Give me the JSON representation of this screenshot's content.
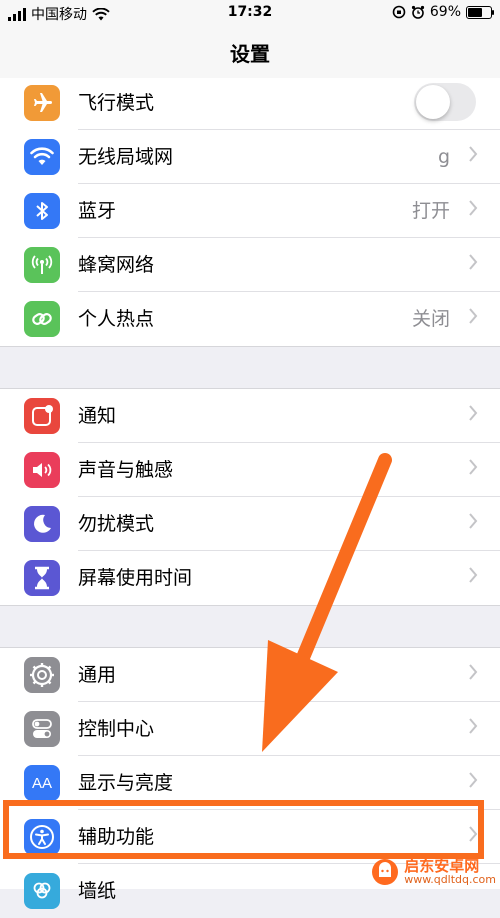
{
  "status_bar": {
    "carrier": "中国移动",
    "time": "17:32",
    "battery_percent": "69%",
    "battery_level": 0.69
  },
  "nav": {
    "title": "设置"
  },
  "group1": [
    {
      "label": "飞行模式",
      "icon": "airplane-icon",
      "color": "#f19a37",
      "toggle": false
    },
    {
      "label": "无线局域网",
      "icon": "wifi-icon",
      "color": "#3478f6",
      "value": "g"
    },
    {
      "label": "蓝牙",
      "icon": "bluetooth-icon",
      "color": "#3478f6",
      "value": "打开"
    },
    {
      "label": "蜂窝网络",
      "icon": "antenna-icon",
      "color": "#5ac35a"
    },
    {
      "label": "个人热点",
      "icon": "hotspot-icon",
      "color": "#5ac35a",
      "value": "关闭"
    }
  ],
  "group2": [
    {
      "label": "通知",
      "icon": "notification-icon",
      "color": "#e9473d"
    },
    {
      "label": "声音与触感",
      "icon": "speaker-icon",
      "color": "#ea3d5b"
    },
    {
      "label": "勿扰模式",
      "icon": "moon-icon",
      "color": "#5b57d3"
    },
    {
      "label": "屏幕使用时间",
      "icon": "hourglass-icon",
      "color": "#5b57d3"
    }
  ],
  "group3": [
    {
      "label": "通用",
      "icon": "gear-icon",
      "color": "#8e8e93"
    },
    {
      "label": "控制中心",
      "icon": "toggles-icon",
      "color": "#8e8e93"
    },
    {
      "label": "显示与亮度",
      "icon": "text-size-icon",
      "color": "#3478f6",
      "icon_text": "AA"
    },
    {
      "label": "辅助功能",
      "icon": "accessibility-icon",
      "color": "#3478f6"
    },
    {
      "label": "墙纸",
      "icon": "wallpaper-icon",
      "color": "#36aadc"
    }
  ],
  "colors": {
    "annotation": "#f96c1e"
  },
  "watermark": {
    "title": "启东安卓网",
    "url": "www.qdltdq.com"
  }
}
